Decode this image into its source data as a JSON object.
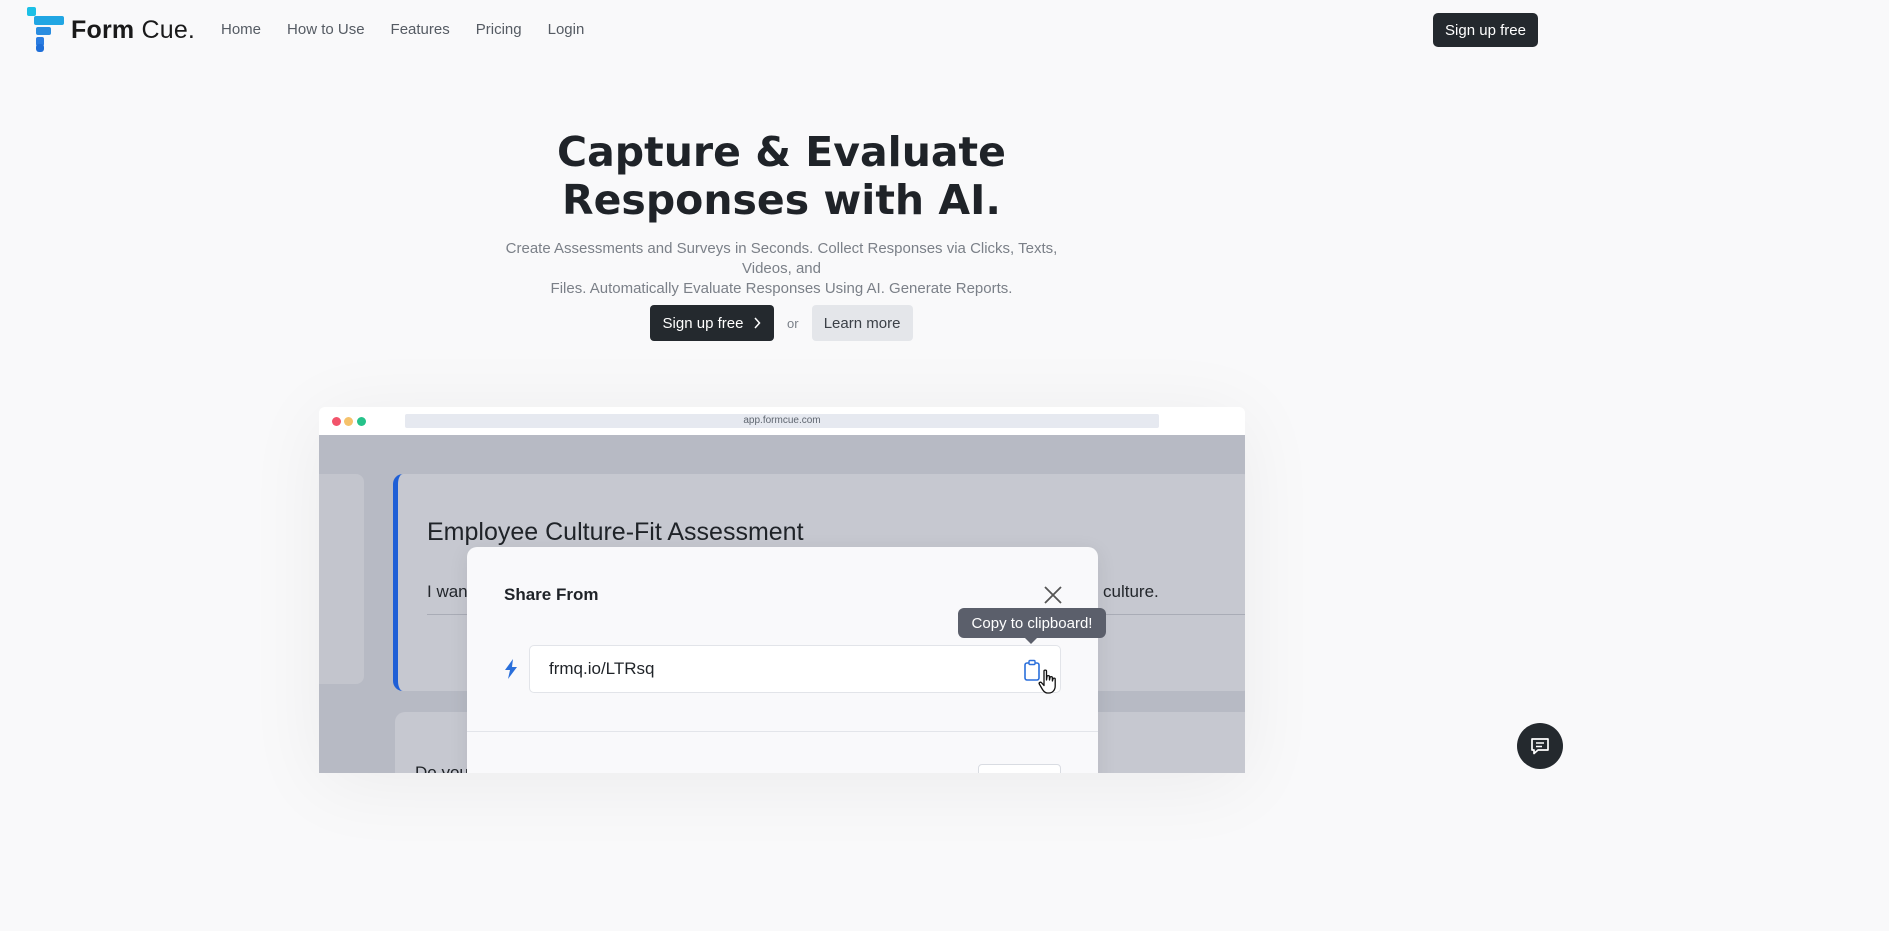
{
  "nav": {
    "logo_bold": "Form",
    "logo_light": "Cue.",
    "links": [
      "Home",
      "How to Use",
      "Features",
      "Pricing",
      "Login"
    ],
    "cta": "Sign up free"
  },
  "hero": {
    "title_line1": "Capture & Evaluate",
    "title_line2": "Responses with AI.",
    "subtitle_line1": "Create Assessments and Surveys in Seconds. Collect Responses via Clicks, Texts, Videos, and",
    "subtitle_line2": "Files. Automatically Evaluate Responses Using AI. Generate Reports.",
    "primary_button": "Sign up free",
    "or": "or",
    "secondary_button": "Learn more"
  },
  "mockup": {
    "url": "app.formcue.com",
    "form_title": "Employee Culture-Fit Assessment",
    "form_desc_start": "I want",
    "form_desc_end": "culture.",
    "question_start": "Do you",
    "modal": {
      "title": "Share From",
      "link": "frmq.io/LTRsq",
      "tooltip": "Copy to clipboard!"
    }
  },
  "icons": {
    "logo": "form-cue-logo-icon",
    "chevron": "chevron-right-icon",
    "close": "close-icon",
    "bolt": "lightning-bolt-icon",
    "clipboard": "clipboard-icon",
    "cursor": "hand-pointer-icon",
    "chat": "chat-icon"
  },
  "colors": {
    "dark": "#24292e",
    "accent_blue": "#1f5fd6",
    "logo_cyan": "#1cb5e0",
    "logo_blue": "#2a7de1"
  }
}
